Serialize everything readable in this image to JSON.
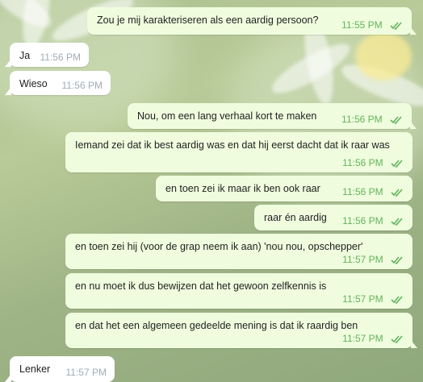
{
  "messages": [
    {
      "dir": "out",
      "text": "Zou je mij karakteriseren als een aardig persoon?",
      "time": "11:55 PM",
      "read": true
    },
    {
      "dir": "in",
      "text": "Ja",
      "time": "11:56 PM"
    },
    {
      "dir": "in",
      "text": "Wieso",
      "time": "11:56 PM"
    },
    {
      "dir": "out",
      "text": "Nou, om een lang verhaal kort te maken",
      "time": "11:56 PM",
      "read": true
    },
    {
      "dir": "out",
      "text": "Iemand zei dat ik best aardig was en dat hij eerst dacht dat ik raar was",
      "time": "11:56 PM",
      "read": true
    },
    {
      "dir": "out",
      "text": "en toen zei ik maar ik ben ook raar",
      "time": "11:56 PM",
      "read": true
    },
    {
      "dir": "out",
      "text": "raar én aardig",
      "time": "11:56 PM",
      "read": true
    },
    {
      "dir": "out",
      "text": "en toen zei hij (voor de grap neem ik aan) 'nou nou, opschepper'",
      "time": "11:57 PM",
      "read": true
    },
    {
      "dir": "out",
      "text": "en nu moet ik dus bewijzen dat het gewoon zelfkennis is",
      "time": "11:57 PM",
      "read": true
    },
    {
      "dir": "out",
      "text": "en dat het een algemeen gedeelde mening is dat ik raardig ben",
      "time": "11:57 PM",
      "read": true
    },
    {
      "dir": "in",
      "text": "Lenker",
      "time": "11:57 PM"
    }
  ],
  "colors": {
    "outgoing_bubble": "#effdde",
    "incoming_bubble": "#ffffff",
    "read_check": "#63b35b",
    "incoming_time": "#a0acb6"
  },
  "icons": {
    "read_receipt": "double-check-icon"
  }
}
